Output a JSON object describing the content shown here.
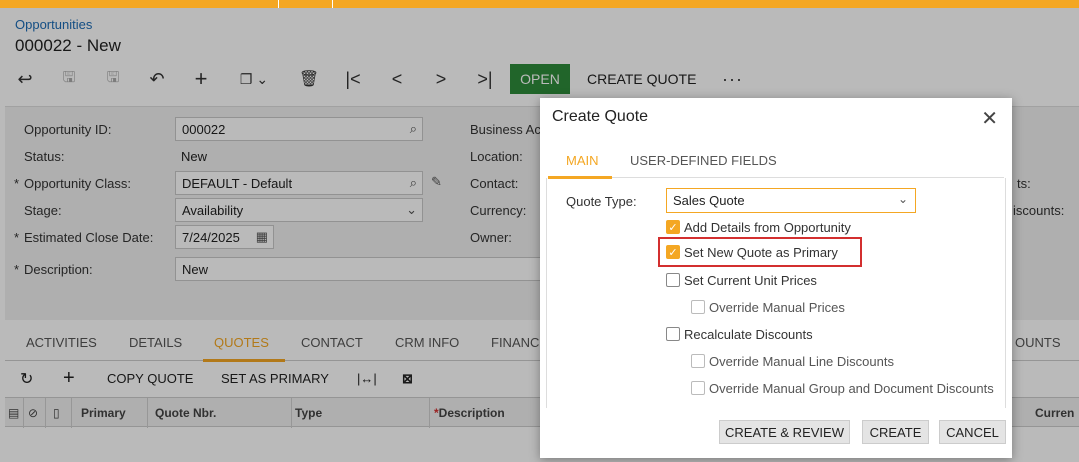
{
  "breadcrumb": "Opportunities",
  "page_title": "000022 - New",
  "toolbar": {
    "open_label": "OPEN",
    "create_quote_label": "CREATE QUOTE",
    "more_label": "···"
  },
  "form": {
    "opportunity_id_label": "Opportunity ID:",
    "opportunity_id_value": "000022",
    "status_label": "Status:",
    "status_value": "New",
    "class_label": "Opportunity Class:",
    "class_value": "DEFAULT - Default",
    "stage_label": "Stage:",
    "stage_value": "Availability",
    "close_date_label": "Estimated Close Date:",
    "close_date_value": "7/24/2025",
    "description_label": "Description:",
    "description_value": "New",
    "business_account_label": "Business Ac",
    "location_label": "Location:",
    "contact_label": "Contact:",
    "currency_label": "Currency:",
    "owner_label": "Owner:",
    "right_label_1": "ts:",
    "right_label_2": "iscounts:"
  },
  "tabs": [
    "ACTIVITIES",
    "DETAILS",
    "QUOTES",
    "CONTACT",
    "CRM INFO",
    "FINANC",
    "OUNTS"
  ],
  "grid_toolbar": {
    "copy_quote": "COPY QUOTE",
    "set_as_primary": "SET AS PRIMARY"
  },
  "grid_columns": {
    "primary": "Primary",
    "quote_nbr": "Quote Nbr.",
    "type": "Type",
    "description": "Description",
    "currency": "Curren"
  },
  "dialog": {
    "title": "Create Quote",
    "tab_main": "MAIN",
    "tab_udf": "USER-DEFINED FIELDS",
    "quote_type_label": "Quote Type:",
    "quote_type_value": "Sales Quote",
    "options": {
      "add_details": "Add Details from Opportunity",
      "set_primary": "Set New Quote as Primary",
      "set_current_prices": "Set Current Unit Prices",
      "override_manual_prices": "Override Manual Prices",
      "recalc_discounts": "Recalculate Discounts",
      "override_line_discounts": "Override Manual Line Discounts",
      "override_group_discounts": "Override Manual Group and Document Discounts"
    },
    "buttons": {
      "create_review": "CREATE & REVIEW",
      "create": "CREATE",
      "cancel": "CANCEL"
    }
  },
  "colors": {
    "accent": "#f4a723",
    "open_button": "#2e8b3a",
    "link": "#1c6cb5",
    "highlight": "#d32f2f"
  }
}
